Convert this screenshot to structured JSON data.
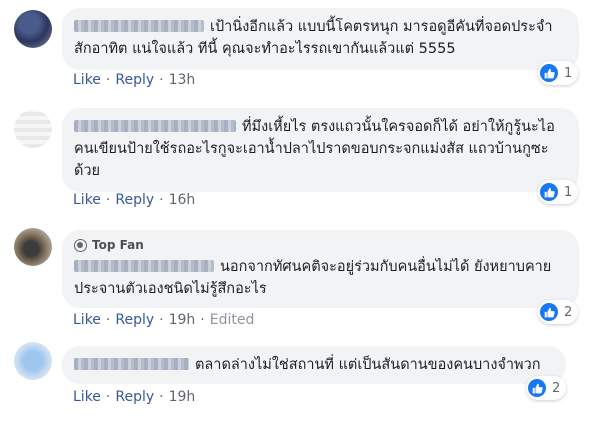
{
  "comments": [
    {
      "text": "เป้านิ่งอีกแล้ว แบบนี้โคตรหนุก มารอดูอีคันที่จอดประจำสักอาทิต แน่ใจแล้ว ทีนี้ คุณจะทำอะไรรถเขากันแล้วแต่ 5555",
      "top_fan": "",
      "like": "Like",
      "reply": "Reply",
      "time": "13h",
      "edited": "",
      "reactions": "1"
    },
    {
      "text": "ที่มึงเหี้ยไร ตรงแถวนั้นใครจอดก็ได้ อย่าให้กูรู้นะไอคนเขียนป้ายใช้รถอะไรกูจะเอาน้ำปลาไปราดขอบกระจกแม่งสัส แถวบ้านกูซะด้วย",
      "top_fan": "",
      "like": "Like",
      "reply": "Reply",
      "time": "16h",
      "edited": "",
      "reactions": "1"
    },
    {
      "text": "นอกจากทัศนคติจะอยู่ร่วมกับคนอื่นไม่ได้ ยังหยาบคายประจานตัวเองชนิดไม่รู้สึกอะไร",
      "top_fan": "Top Fan",
      "like": "Like",
      "reply": "Reply",
      "time": "19h",
      "edited": "Edited",
      "reactions": "2"
    },
    {
      "text": "ตลาดล่างไม่ใช่สถานที่ แต่เป็นสันดานของคนบางจำพวก",
      "top_fan": "",
      "like": "Like",
      "reply": "Reply",
      "time": "19h",
      "edited": "",
      "reactions": "2"
    }
  ],
  "colors": {
    "bubble": "#f2f3f5",
    "link": "#385898",
    "meta": "#606770",
    "like_blue": "#1877f2"
  }
}
